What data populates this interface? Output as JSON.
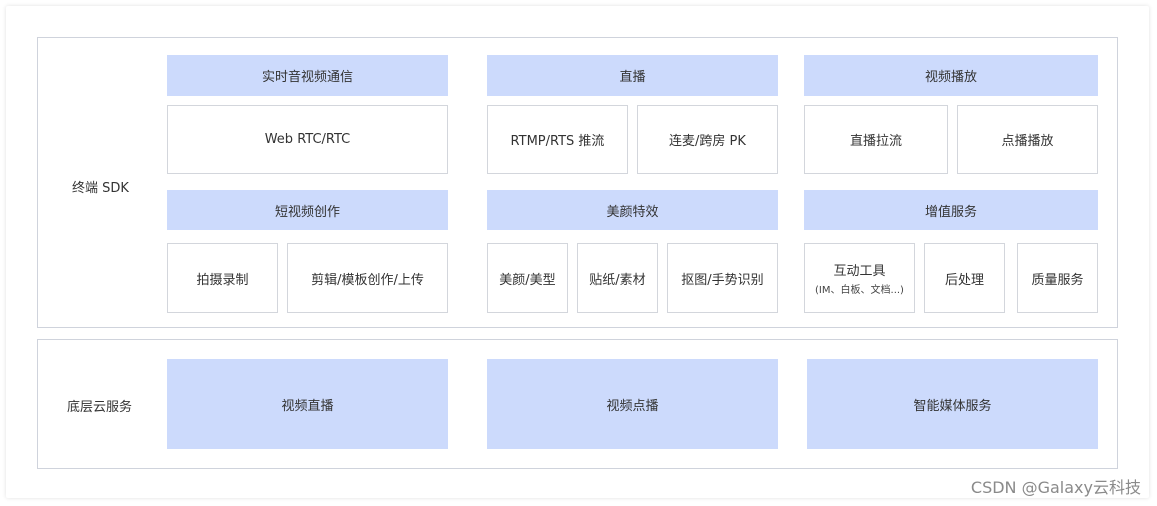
{
  "sdk": {
    "label": "终端 SDK",
    "rtc": {
      "title": "实时音视频通信",
      "items": [
        "Web RTC/RTC"
      ]
    },
    "live": {
      "title": "直播",
      "items": [
        "RTMP/RTS 推流",
        "连麦/跨房 PK"
      ]
    },
    "playback": {
      "title": "视频播放",
      "items": [
        "直播拉流",
        "点播播放"
      ]
    },
    "shortvideo": {
      "title": "短视频创作",
      "items": [
        "拍摄录制",
        "剪辑/模板创作/上传"
      ]
    },
    "beauty": {
      "title": "美颜特效",
      "items": [
        "美颜/美型",
        "贴纸/素材",
        "抠图/手势识别"
      ]
    },
    "value": {
      "title": "增值服务",
      "items": [
        {
          "label": "互动工具",
          "sub": "(IM、白板、文档...)"
        },
        {
          "label": "后处理"
        },
        {
          "label": "质量服务"
        }
      ]
    }
  },
  "cloud": {
    "label": "底层云服务",
    "items": [
      "视频直播",
      "视频点播",
      "智能媒体服务"
    ]
  },
  "watermark": "CSDN @Galaxy云科技"
}
